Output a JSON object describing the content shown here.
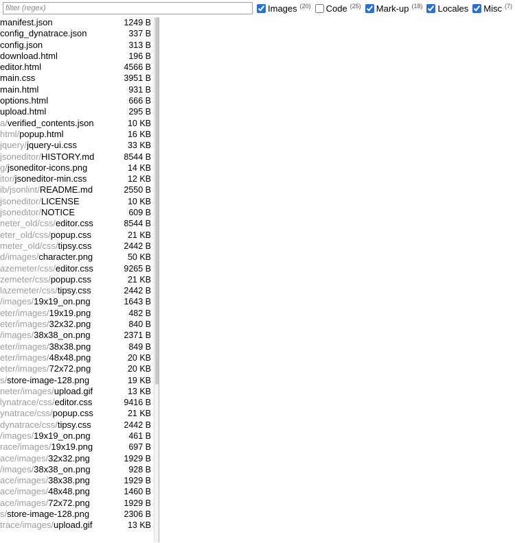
{
  "filter": {
    "placeholder": "filter (regex)",
    "value": ""
  },
  "filters": [
    {
      "id": "images",
      "label": "Images",
      "count": "(20)",
      "checked": true
    },
    {
      "id": "code",
      "label": "Code",
      "count": "(25)",
      "checked": false
    },
    {
      "id": "markup",
      "label": "Mark-up",
      "count": "(18)",
      "checked": true
    },
    {
      "id": "locales",
      "label": "Locales",
      "count": "",
      "checked": true
    },
    {
      "id": "misc",
      "label": "Misc",
      "count": "(7)",
      "checked": true
    }
  ],
  "files": [
    {
      "path": "",
      "name": "manifest.json",
      "size": "1249 B"
    },
    {
      "path": "",
      "name": "config_dynatrace.json",
      "size": "337 B"
    },
    {
      "path": "",
      "name": "config.json",
      "size": "313 B"
    },
    {
      "path": "",
      "name": "download.html",
      "size": "196 B"
    },
    {
      "path": "",
      "name": "editor.html",
      "size": "4566 B"
    },
    {
      "path": "",
      "name": "main.css",
      "size": "3951 B"
    },
    {
      "path": "",
      "name": "main.html",
      "size": "931 B"
    },
    {
      "path": "",
      "name": "options.html",
      "size": "666 B"
    },
    {
      "path": "",
      "name": "upload.html",
      "size": "295 B"
    },
    {
      "path": "a/",
      "name": "verified_contents.json",
      "size": "10 KB"
    },
    {
      "path": "html/",
      "name": "popup.html",
      "size": "16 KB"
    },
    {
      "path": "jquery/",
      "name": "jquery-ui.css",
      "size": "33 KB"
    },
    {
      "path": "jsoneditor/",
      "name": "HISTORY.md",
      "size": "8544 B"
    },
    {
      "path": "g/",
      "name": "jsoneditor-icons.png",
      "size": "14 KB"
    },
    {
      "path": "itor/",
      "name": "jsoneditor-min.css",
      "size": "12 KB"
    },
    {
      "path": "ib/jsonlint/",
      "name": "README.md",
      "size": "2550 B"
    },
    {
      "path": "jsoneditor/",
      "name": "LICENSE",
      "size": "10 KB"
    },
    {
      "path": "jsoneditor/",
      "name": "NOTICE",
      "size": "609 B"
    },
    {
      "path": "neter_old/css/",
      "name": "editor.css",
      "size": "8544 B"
    },
    {
      "path": "eter_old/css/",
      "name": "popup.css",
      "size": "21 KB"
    },
    {
      "path": "meter_old/css/",
      "name": "tipsy.css",
      "size": "2442 B"
    },
    {
      "path": "d/images/",
      "name": "character.png",
      "size": "50 KB"
    },
    {
      "path": "azemeter/css/",
      "name": "editor.css",
      "size": "9265 B"
    },
    {
      "path": "zemeter/css/",
      "name": "popup.css",
      "size": "21 KB"
    },
    {
      "path": "lazemeter/css/",
      "name": "tipsy.css",
      "size": "2442 B"
    },
    {
      "path": "/images/",
      "name": "19x19_on.png",
      "size": "1643 B"
    },
    {
      "path": "eter/images/",
      "name": "19x19.png",
      "size": "482 B"
    },
    {
      "path": "eter/images/",
      "name": "32x32.png",
      "size": "840 B"
    },
    {
      "path": "/images/",
      "name": "38x38_on.png",
      "size": "2371 B"
    },
    {
      "path": "eter/images/",
      "name": "38x38.png",
      "size": "849 B"
    },
    {
      "path": "eter/images/",
      "name": "48x48.png",
      "size": "20 KB"
    },
    {
      "path": "eter/images/",
      "name": "72x72.png",
      "size": "20 KB"
    },
    {
      "path": "s/",
      "name": "store-image-128.png",
      "size": "19 KB"
    },
    {
      "path": "neter/images/",
      "name": "upload.gif",
      "size": "13 KB"
    },
    {
      "path": "lynatrace/css/",
      "name": "editor.css",
      "size": "9416 B"
    },
    {
      "path": "ynatrace/css/",
      "name": "popup.css",
      "size": "21 KB"
    },
    {
      "path": "dynatrace/css/",
      "name": "tipsy.css",
      "size": "2442 B"
    },
    {
      "path": "/images/",
      "name": "19x19_on.png",
      "size": "461 B"
    },
    {
      "path": "race/images/",
      "name": "19x19.png",
      "size": "697 B"
    },
    {
      "path": "ace/images/",
      "name": "32x32.png",
      "size": "1929 B"
    },
    {
      "path": "/images/",
      "name": "38x38_on.png",
      "size": "928 B"
    },
    {
      "path": "ace/images/",
      "name": "38x38.png",
      "size": "1929 B"
    },
    {
      "path": "ace/images/",
      "name": "48x48.png",
      "size": "1460 B"
    },
    {
      "path": "ace/images/",
      "name": "72x72.png",
      "size": "1929 B"
    },
    {
      "path": "s/",
      "name": "store-image-128.png",
      "size": "2306 B"
    },
    {
      "path": "trace/images/",
      "name": "upload.gif",
      "size": "13 KB"
    }
  ]
}
